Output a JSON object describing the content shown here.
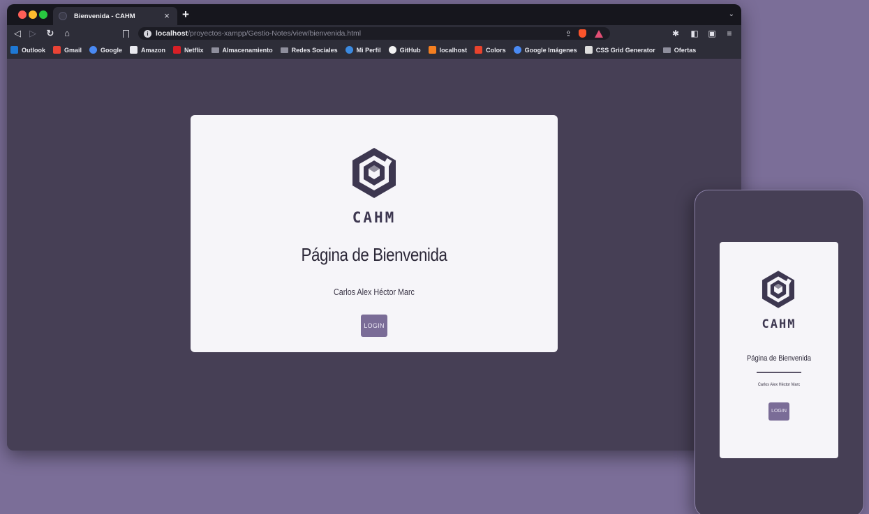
{
  "browser": {
    "tab_title": "Bienvenida - CAHM",
    "tab_close": "×",
    "new_tab": "+",
    "tab_list": "⌄",
    "url_host": "localhost",
    "url_path": "/proyectos-xampp/Gestio-Notes/view/bienvenida.html",
    "bookmarks": [
      {
        "label": "Outlook",
        "icon": "outlook-icon",
        "color": "#1e78d4"
      },
      {
        "label": "Gmail",
        "icon": "gmail-icon",
        "color": "#e94335"
      },
      {
        "label": "Google",
        "icon": "google-icon",
        "color": "#4a8af4"
      },
      {
        "label": "Amazon",
        "icon": "amazon-icon",
        "color": "#e8e8ee"
      },
      {
        "label": "Netflix",
        "icon": "netflix-icon",
        "color": "#d81f26"
      },
      {
        "label": "Almacenamiento",
        "icon": "folder-icon",
        "color": "#8e8e9c"
      },
      {
        "label": "Redes Sociales",
        "icon": "folder-icon",
        "color": "#8e8e9c"
      },
      {
        "label": "Mi Perfil",
        "icon": "profile-icon",
        "color": "#3b8ae0"
      },
      {
        "label": "GitHub",
        "icon": "github-icon",
        "color": "#f2f2f2"
      },
      {
        "label": "localhost",
        "icon": "xampp-icon",
        "color": "#f57f20"
      },
      {
        "label": "Colors",
        "icon": "colors-icon",
        "color": "#e8432d"
      },
      {
        "label": "Google Imágenes",
        "icon": "google-icon",
        "color": "#4a8af4"
      },
      {
        "label": "CSS Grid Generator",
        "icon": "grid-icon",
        "color": "#dddddd"
      },
      {
        "label": "Ofertas",
        "icon": "folder-icon",
        "color": "#8e8e9c"
      }
    ]
  },
  "page": {
    "brand": "CAHM",
    "title": "Página de Bienvenida",
    "authors": "Carlos Alex Héctor Marc",
    "login_label": "LOGIN"
  },
  "mobile": {
    "brand": "CAHM",
    "title": "Página de Bienvenida",
    "authors": "Carlos Alex Héctor Marc",
    "login_label": "LOGIN"
  },
  "colors": {
    "background": "#7b6e98",
    "page_bg": "#463f55",
    "card_bg": "#f6f5f9",
    "accent": "#7a6c97",
    "logo": "#3d3750"
  }
}
